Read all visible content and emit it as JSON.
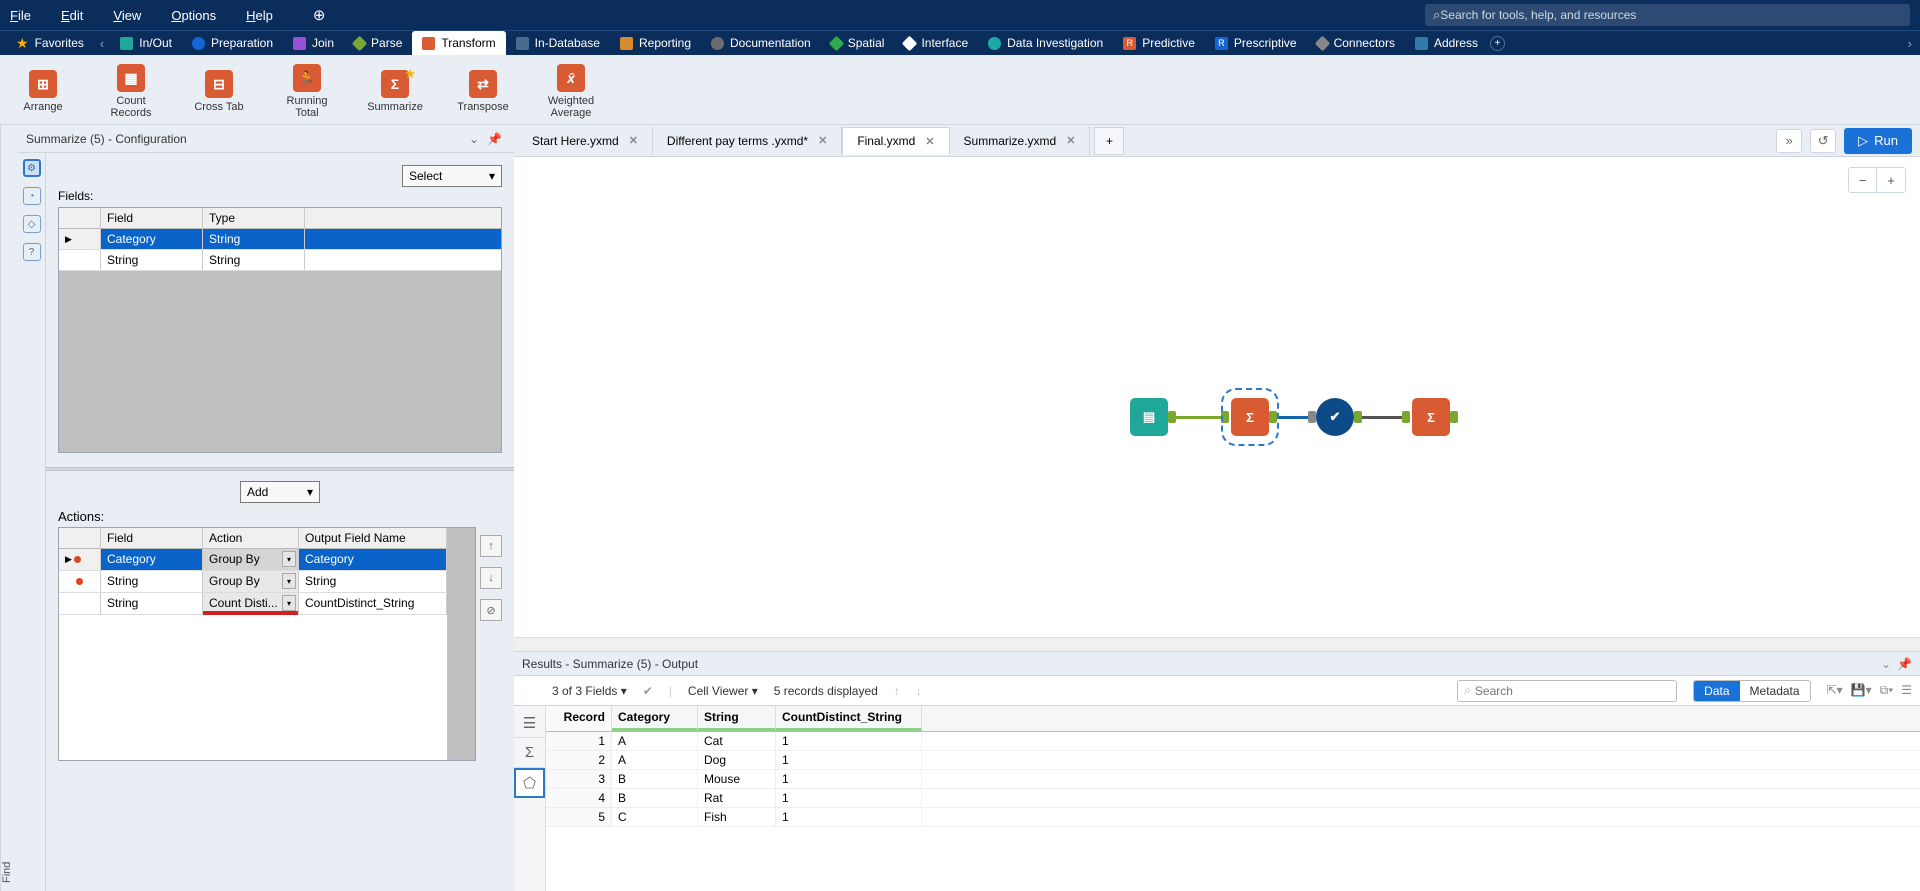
{
  "menu": {
    "file": "File",
    "edit": "Edit",
    "view": "View",
    "options": "Options",
    "help": "Help",
    "search_placeholder": "Search for tools, help, and resources"
  },
  "categories": {
    "favorites": "Favorites",
    "inout": "In/Out",
    "preparation": "Preparation",
    "join": "Join",
    "parse": "Parse",
    "transform": "Transform",
    "indatabase": "In-Database",
    "reporting": "Reporting",
    "documentation": "Documentation",
    "spatial": "Spatial",
    "interface": "Interface",
    "datainv": "Data Investigation",
    "predictive": "Predictive",
    "prescriptive": "Prescriptive",
    "connectors": "Connectors",
    "address": "Address"
  },
  "tools": {
    "arrange": "Arrange",
    "countrecords": "Count Records",
    "crosstab": "Cross Tab",
    "runningtotal": "Running Total",
    "summarize": "Summarize",
    "transpose": "Transpose",
    "weightedavg": "Weighted Average"
  },
  "config": {
    "title": "Summarize (5) - Configuration",
    "fields_label": "Fields:",
    "select_label": "Select",
    "headers": {
      "field": "Field",
      "type": "Type"
    },
    "rows": [
      {
        "field": "Category",
        "type": "String"
      },
      {
        "field": "String",
        "type": "String"
      }
    ],
    "actions_label": "Actions:",
    "add_label": "Add",
    "aheaders": {
      "field": "Field",
      "action": "Action",
      "output": "Output Field Name"
    },
    "arows": [
      {
        "field": "Category",
        "action": "Group By",
        "output": "Category"
      },
      {
        "field": "String",
        "action": "Group By",
        "output": "String"
      },
      {
        "field": "String",
        "action": "Count Disti...",
        "output": "CountDistinct_String"
      }
    ]
  },
  "tabs": {
    "t1": "Start Here.yxmd",
    "t2": "Different pay terms .yxmd*",
    "t3": "Final.yxmd",
    "t4": "Summarize.yxmd",
    "run": "Run"
  },
  "sidebar_label": "Find",
  "results": {
    "title": "Results - Summarize (5) - Output",
    "fieldcount": "3 of 3 Fields",
    "cellviewer": "Cell Viewer",
    "recordcount": "5 records displayed",
    "search_placeholder": "Search",
    "data": "Data",
    "metadata": "Metadata",
    "headers": {
      "record": "Record",
      "category": "Category",
      "string": "String",
      "cd": "CountDistinct_String"
    },
    "rows": [
      {
        "r": "1",
        "c": "A",
        "s": "Cat",
        "cd": "1"
      },
      {
        "r": "2",
        "c": "A",
        "s": "Dog",
        "cd": "1"
      },
      {
        "r": "3",
        "c": "B",
        "s": "Mouse",
        "cd": "1"
      },
      {
        "r": "4",
        "c": "B",
        "s": "Rat",
        "cd": "1"
      },
      {
        "r": "5",
        "c": "C",
        "s": "Fish",
        "cd": "1"
      }
    ]
  }
}
